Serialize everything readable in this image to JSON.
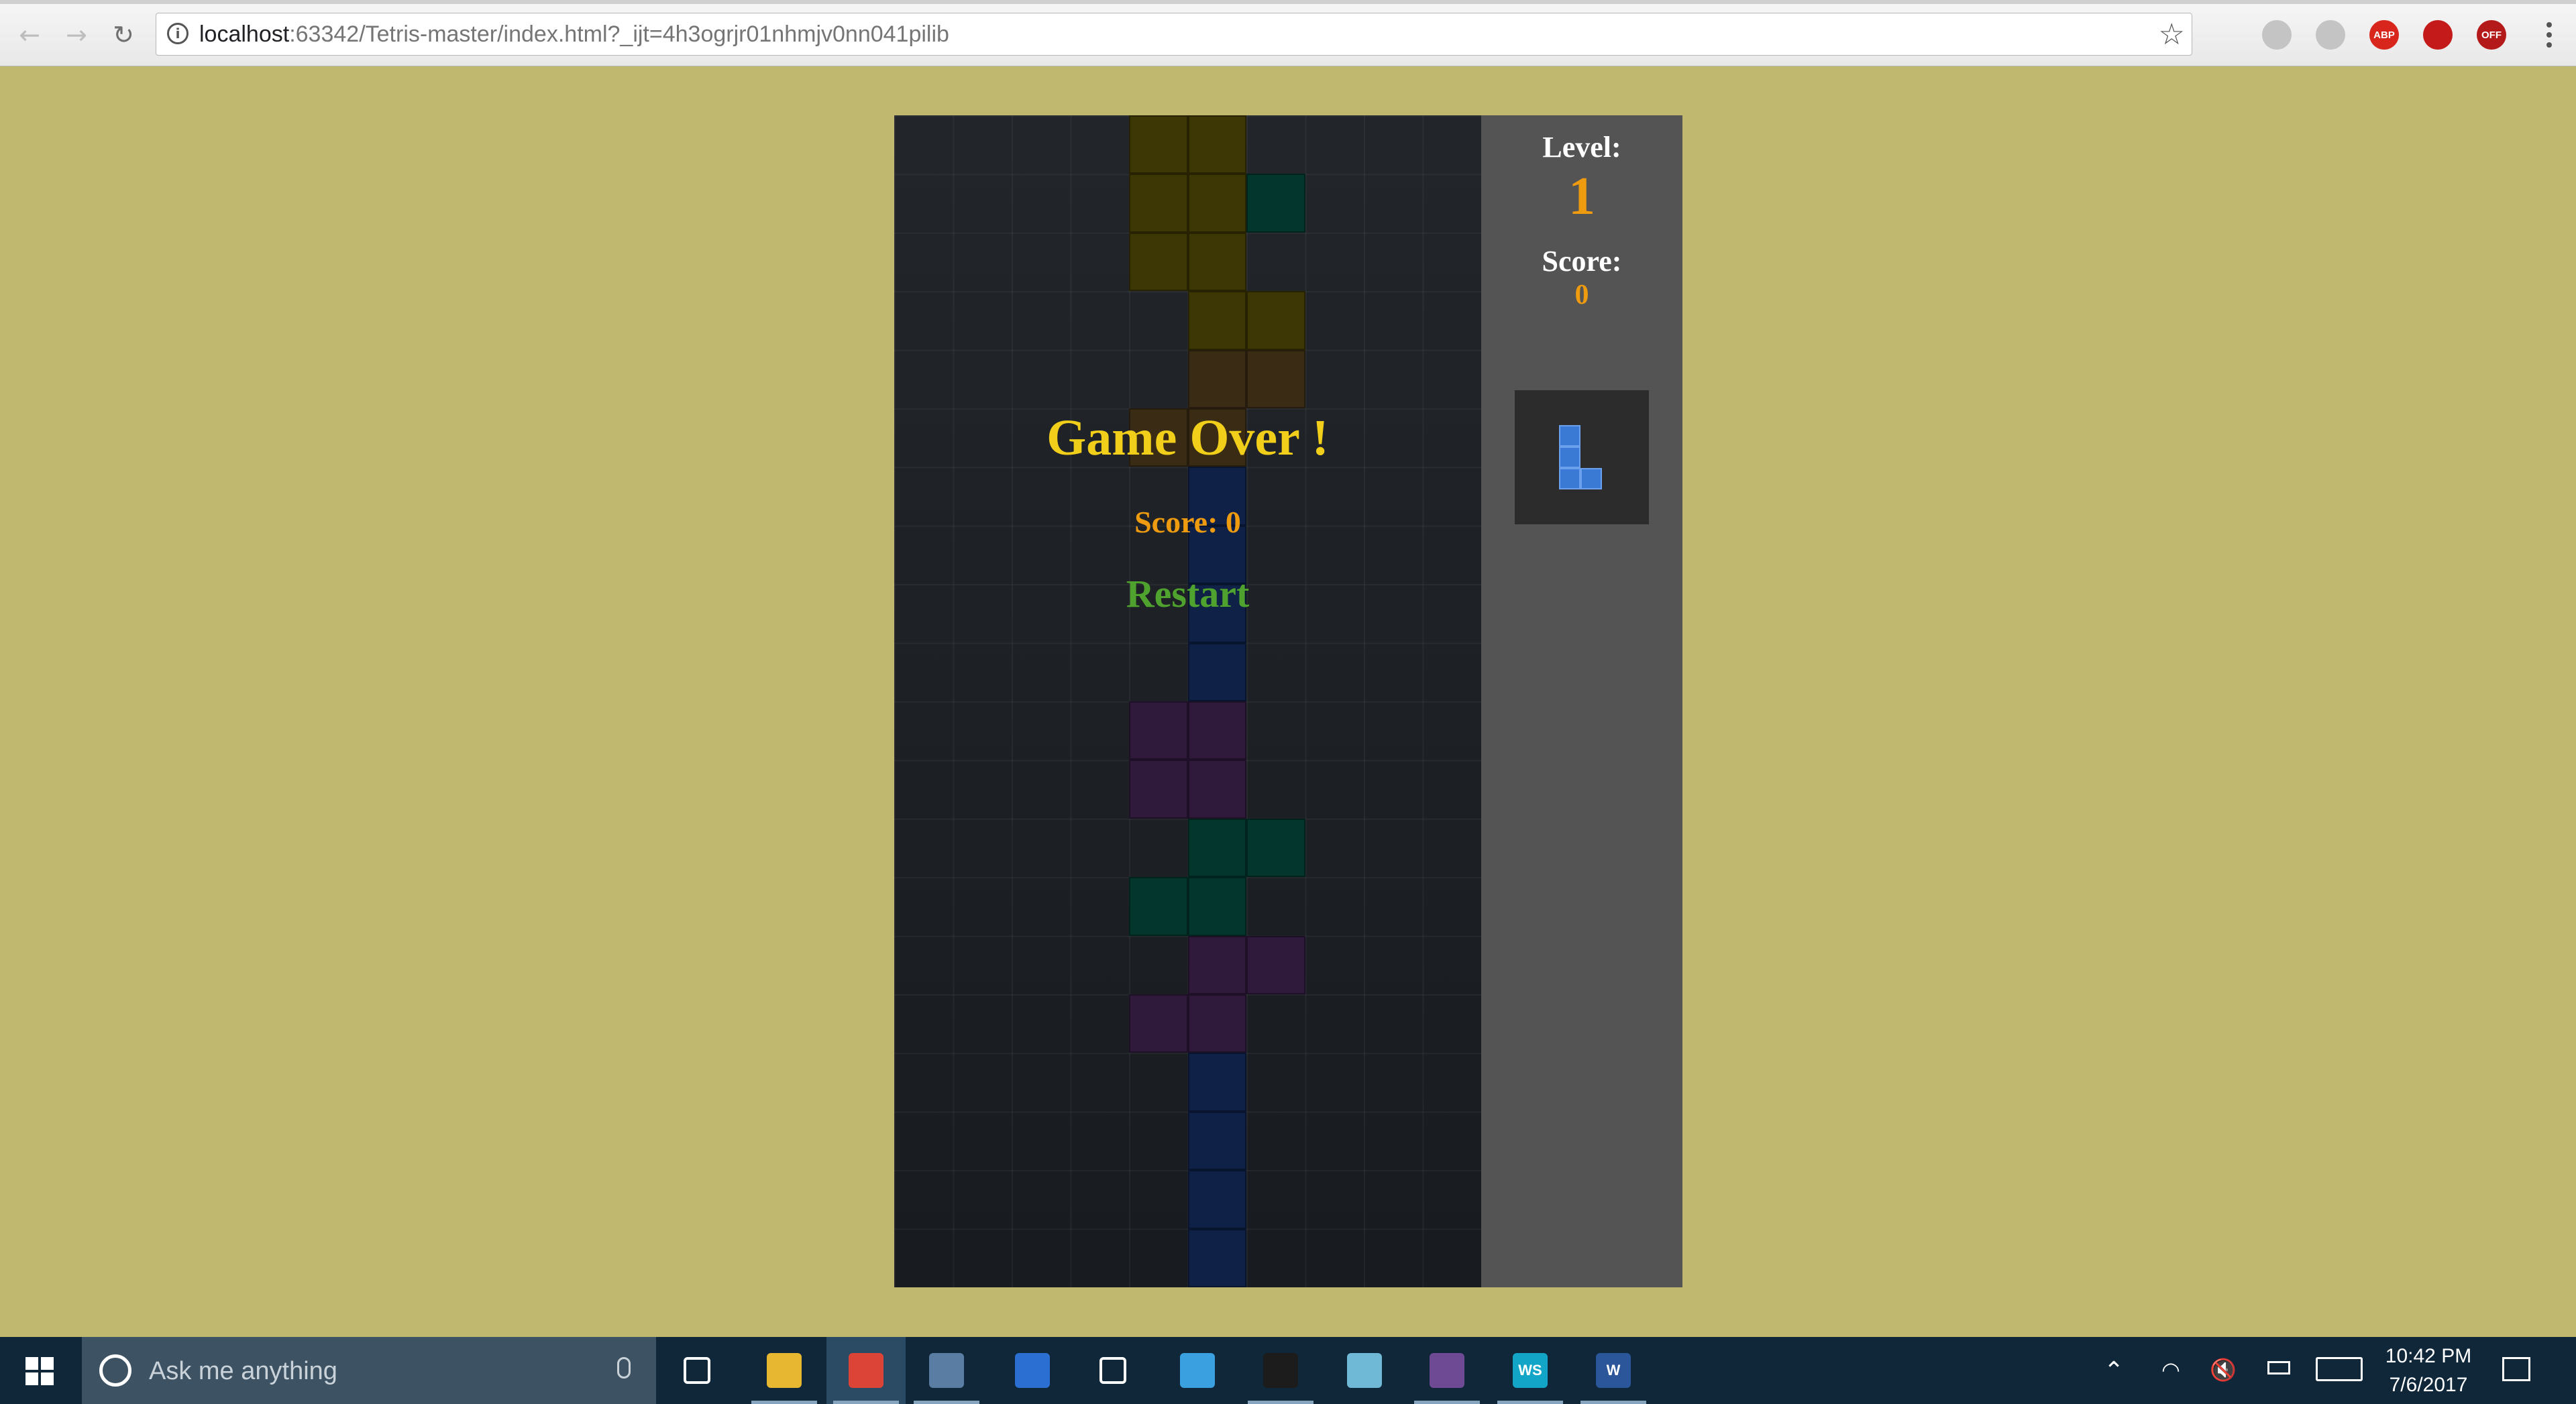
{
  "browser": {
    "url_host": "localhost",
    "url_rest": ":63342/Tetris-master/index.html?_ijt=4h3ogrjr01nhmjv0nn041pilib",
    "extensions": [
      {
        "name": "drive-icon",
        "label": "",
        "color": "#c4c4c4"
      },
      {
        "name": "pdf-icon",
        "label": "",
        "color": "#c4c4c4"
      },
      {
        "name": "adblock-icon",
        "label": "ABP",
        "color": "#d9261c"
      },
      {
        "name": "ublock-icon",
        "label": "",
        "color": "#c51a1a"
      },
      {
        "name": "off-extension-icon",
        "label": "OFF",
        "color": "#b51a1a"
      }
    ]
  },
  "game": {
    "game_over": "Game Over !",
    "final_score": "Score: 0",
    "restart": "Restart",
    "colors": {
      "yellow": "#3c3704",
      "teal": "#03362d",
      "orange": "#3a2c14",
      "blue": "#0f2147",
      "purple": "#2f1a3b"
    },
    "board_cols": 10,
    "board_rows": 20,
    "cells": [
      {
        "c": 4,
        "r": 0,
        "k": "y"
      },
      {
        "c": 5,
        "r": 0,
        "k": "y"
      },
      {
        "c": 4,
        "r": 1,
        "k": "y"
      },
      {
        "c": 5,
        "r": 1,
        "k": "y"
      },
      {
        "c": 6,
        "r": 1,
        "k": "t"
      },
      {
        "c": 4,
        "r": 2,
        "k": "y"
      },
      {
        "c": 5,
        "r": 2,
        "k": "y"
      },
      {
        "c": 5,
        "r": 3,
        "k": "y"
      },
      {
        "c": 6,
        "r": 3,
        "k": "y"
      },
      {
        "c": 5,
        "r": 4,
        "k": "o"
      },
      {
        "c": 6,
        "r": 4,
        "k": "o"
      },
      {
        "c": 4,
        "r": 5,
        "k": "o"
      },
      {
        "c": 5,
        "r": 5,
        "k": "o"
      },
      {
        "c": 5,
        "r": 6,
        "k": "b"
      },
      {
        "c": 5,
        "r": 7,
        "k": "b"
      },
      {
        "c": 5,
        "r": 8,
        "k": "b"
      },
      {
        "c": 5,
        "r": 9,
        "k": "b"
      },
      {
        "c": 4,
        "r": 10,
        "k": "p"
      },
      {
        "c": 5,
        "r": 10,
        "k": "p"
      },
      {
        "c": 4,
        "r": 11,
        "k": "p"
      },
      {
        "c": 5,
        "r": 11,
        "k": "p"
      },
      {
        "c": 5,
        "r": 12,
        "k": "t"
      },
      {
        "c": 6,
        "r": 12,
        "k": "t"
      },
      {
        "c": 4,
        "r": 13,
        "k": "t"
      },
      {
        "c": 5,
        "r": 13,
        "k": "t"
      },
      {
        "c": 5,
        "r": 14,
        "k": "p"
      },
      {
        "c": 6,
        "r": 14,
        "k": "p"
      },
      {
        "c": 4,
        "r": 15,
        "k": "p"
      },
      {
        "c": 5,
        "r": 15,
        "k": "p"
      },
      {
        "c": 5,
        "r": 16,
        "k": "b"
      },
      {
        "c": 5,
        "r": 17,
        "k": "b"
      },
      {
        "c": 5,
        "r": 18,
        "k": "b"
      },
      {
        "c": 5,
        "r": 19,
        "k": "b"
      }
    ]
  },
  "panel": {
    "level_label": "Level:",
    "level_value": "1",
    "score_label": "Score:",
    "score_value": "0",
    "next_piece": "L",
    "next_color": "#3a79d4"
  },
  "taskbar": {
    "search_placeholder": "Ask me anything",
    "apps": [
      {
        "name": "task-view-icon",
        "label": "",
        "color": "transparent",
        "active": false,
        "open": false
      },
      {
        "name": "file-explorer-icon",
        "label": "",
        "color": "#e8b731",
        "active": false,
        "open": true
      },
      {
        "name": "chrome-icon",
        "label": "",
        "color": "#db4437",
        "active": true,
        "open": true
      },
      {
        "name": "virtualbox-icon",
        "label": "",
        "color": "#5a7ea3",
        "active": false,
        "open": true
      },
      {
        "name": "defender-icon",
        "label": "",
        "color": "#2a6fd1",
        "active": false,
        "open": false
      },
      {
        "name": "settings-icon",
        "label": "",
        "color": "transparent",
        "active": false,
        "open": false
      },
      {
        "name": "photos-icon",
        "label": "",
        "color": "#3ba0e0",
        "active": false,
        "open": false
      },
      {
        "name": "terminal-icon",
        "label": "",
        "color": "#1c1c1c",
        "active": false,
        "open": true
      },
      {
        "name": "notes-icon",
        "label": "",
        "color": "#6fb9d6",
        "active": false,
        "open": false
      },
      {
        "name": "github-icon",
        "label": "",
        "color": "#6e4a94",
        "active": false,
        "open": true
      },
      {
        "name": "webstorm-icon",
        "label": "WS",
        "color": "#12a5c8",
        "active": false,
        "open": true
      },
      {
        "name": "word-icon",
        "label": "W",
        "color": "#2b579a",
        "active": false,
        "open": true
      }
    ],
    "clock_time": "10:42 PM",
    "clock_date": "7/6/2017"
  }
}
